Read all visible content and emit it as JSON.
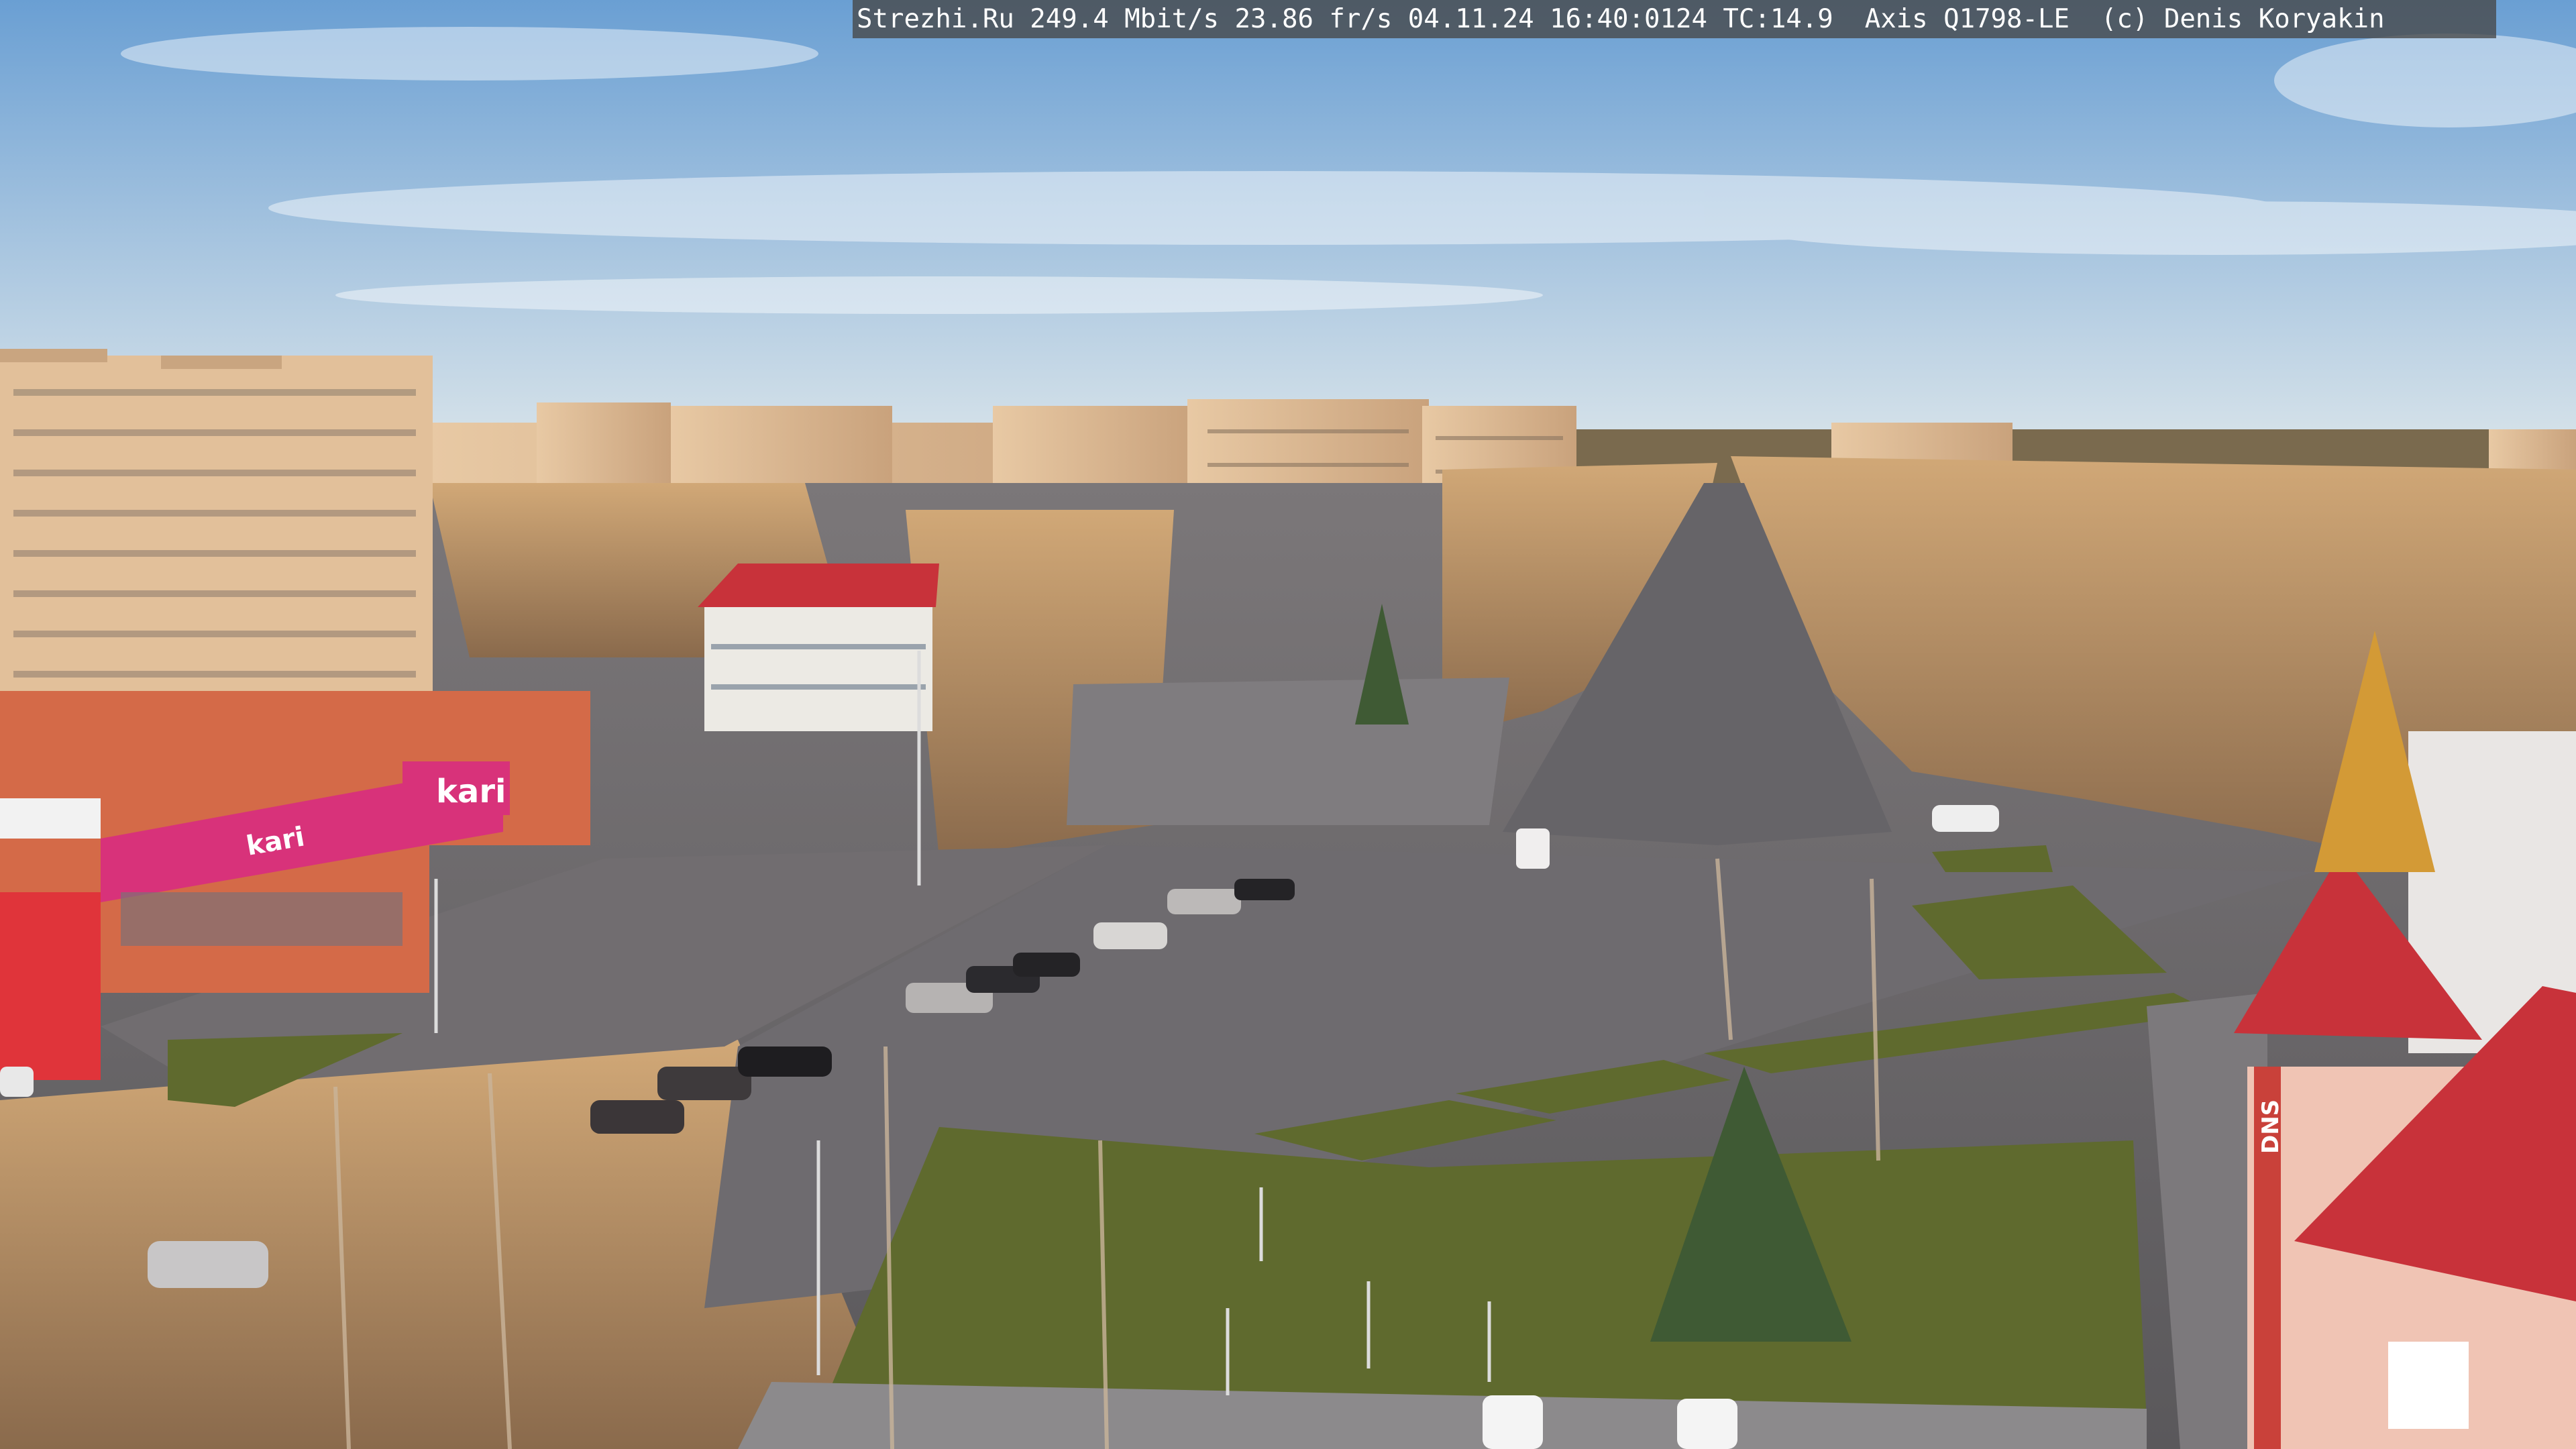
{
  "overlay": {
    "text": "Strezhi.Ru 249.4 Mbit/s 23.86 fr/s 04.11.24 16:40:0124 TC:14.9  Axis Q1798-LE  (c) Denis Koryakin"
  },
  "signs": {
    "store_kari": "kari",
    "store_kari_banner": "kari",
    "store_dns": "DNS"
  },
  "palette": {
    "sky_top": "#6fa2d4",
    "sky_bottom": "#cfe0ec",
    "brick": "#d46a48",
    "kari_pink": "#d8327a",
    "roof_red": "#c8323a",
    "asphalt": "#6f6c70",
    "lawn": "#5d6a2c",
    "birch": "#b98f5e"
  }
}
